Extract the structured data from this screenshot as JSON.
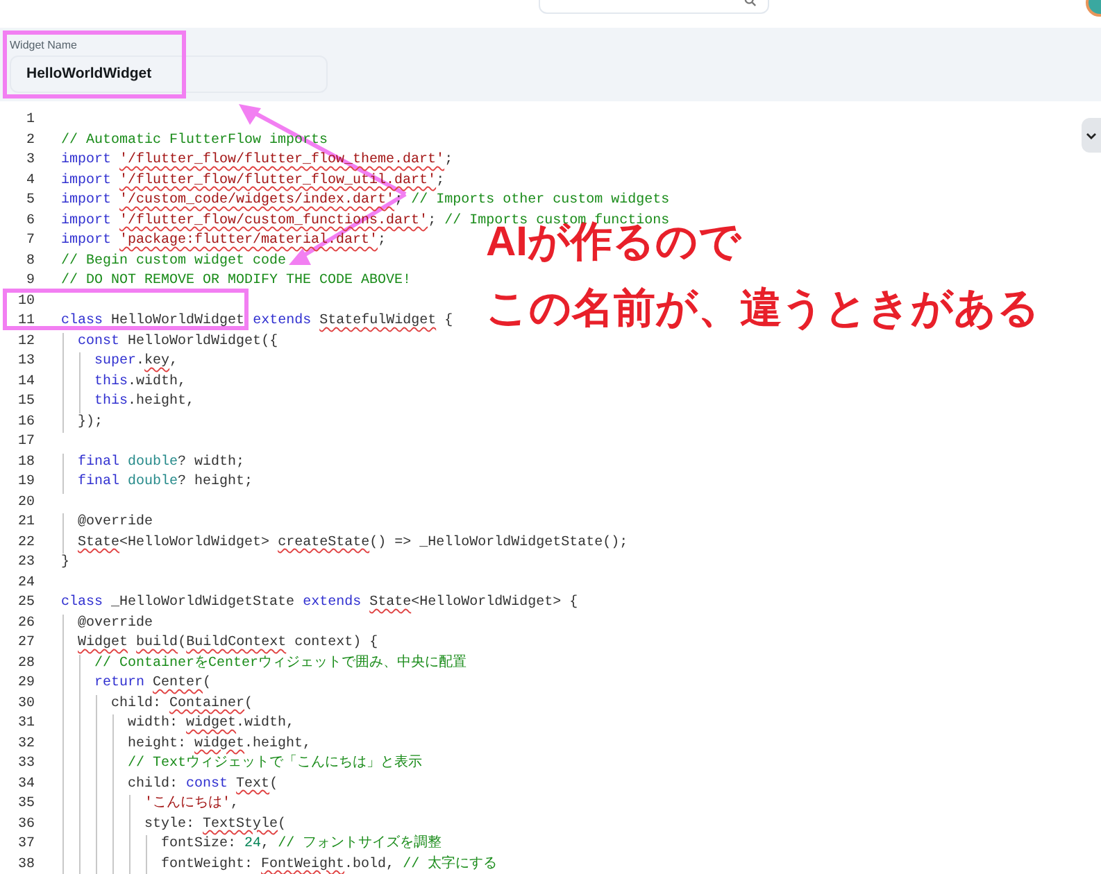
{
  "widget_name": {
    "label": "Widget Name",
    "value": "HelloWorldWidget"
  },
  "code_lines": [
    {
      "number": "1"
    },
    {
      "number": "2",
      "tokens": [
        {
          "text": "// Automatic FlutterFlow imports",
          "kind": "comment"
        }
      ]
    },
    {
      "number": "3",
      "tokens": [
        {
          "text": "import ",
          "kind": "keyword"
        },
        {
          "text": "'/flutter_flow/flutter_flow_theme.dart'",
          "kind": "unresolved_string"
        },
        {
          "text": ";",
          "kind": "plain"
        }
      ]
    },
    {
      "number": "4",
      "tokens": [
        {
          "text": "import ",
          "kind": "keyword"
        },
        {
          "text": "'/flutter_flow/flutter_flow_util.dart'",
          "kind": "unresolved_string"
        },
        {
          "text": ";",
          "kind": "plain"
        }
      ]
    },
    {
      "number": "5",
      "tokens": [
        {
          "text": "import ",
          "kind": "keyword"
        },
        {
          "text": "'/custom_code/widgets/index.dart'",
          "kind": "unresolved_string"
        },
        {
          "text": "; ",
          "kind": "plain"
        },
        {
          "text": "// Imports other custom widgets",
          "kind": "comment"
        }
      ]
    },
    {
      "number": "6",
      "tokens": [
        {
          "text": "import ",
          "kind": "keyword"
        },
        {
          "text": "'/flutter_flow/custom_functions.dart'",
          "kind": "unresolved_string"
        },
        {
          "text": "; ",
          "kind": "plain"
        },
        {
          "text": "// Imports custom functions",
          "kind": "comment"
        }
      ]
    },
    {
      "number": "7",
      "tokens": [
        {
          "text": "import ",
          "kind": "keyword"
        },
        {
          "text": "'package:flutter/material.dart'",
          "kind": "unresolved_string"
        },
        {
          "text": ";",
          "kind": "plain"
        }
      ]
    },
    {
      "number": "8",
      "tokens": [
        {
          "text": "// Begin custom widget code",
          "kind": "comment"
        }
      ]
    },
    {
      "number": "9",
      "tokens": [
        {
          "text": "// DO NOT REMOVE OR MODIFY THE CODE ABOVE!",
          "kind": "comment"
        }
      ]
    },
    {
      "number": "10"
    },
    {
      "number": "11",
      "tokens": [
        {
          "text": "class",
          "kind": "keyword"
        },
        {
          "text": " HelloWorldWidget ",
          "kind": "plain"
        },
        {
          "text": "extends ",
          "kind": "keyword"
        },
        {
          "text": "StatefulWidget",
          "kind": "unresolved"
        },
        {
          "text": " {",
          "kind": "plain"
        }
      ]
    },
    {
      "number": "12",
      "tokens": [
        {
          "text": "  const",
          "kind": "keyword"
        },
        {
          "text": " HelloWorldWidget({",
          "kind": "plain"
        }
      ]
    },
    {
      "number": "13",
      "tokens": [
        {
          "text": "    super",
          "kind": "keyword"
        },
        {
          "text": ".",
          "kind": "plain"
        },
        {
          "text": "key",
          "kind": "unresolved"
        },
        {
          "text": ",",
          "kind": "plain"
        }
      ]
    },
    {
      "number": "14",
      "tokens": [
        {
          "text": "    this",
          "kind": "keyword"
        },
        {
          "text": ".width,",
          "kind": "plain"
        }
      ]
    },
    {
      "number": "15",
      "tokens": [
        {
          "text": "    this",
          "kind": "keyword"
        },
        {
          "text": ".height,",
          "kind": "plain"
        }
      ]
    },
    {
      "number": "16",
      "tokens": [
        {
          "text": "  });",
          "kind": "plain"
        }
      ]
    },
    {
      "number": "17"
    },
    {
      "number": "18",
      "tokens": [
        {
          "text": "  final ",
          "kind": "keyword"
        },
        {
          "text": "double",
          "kind": "type"
        },
        {
          "text": "? width;",
          "kind": "plain"
        }
      ]
    },
    {
      "number": "19",
      "tokens": [
        {
          "text": "  final ",
          "kind": "keyword"
        },
        {
          "text": "double",
          "kind": "type"
        },
        {
          "text": "? height;",
          "kind": "plain"
        }
      ]
    },
    {
      "number": "20"
    },
    {
      "number": "21",
      "tokens": [
        {
          "text": "  @override",
          "kind": "plain"
        }
      ]
    },
    {
      "number": "22",
      "tokens": [
        {
          "text": "  State",
          "kind": "unresolved"
        },
        {
          "text": "<HelloWorldWidget> ",
          "kind": "plain"
        },
        {
          "text": "createState",
          "kind": "unresolved"
        },
        {
          "text": "() => _HelloWorldWidgetState();",
          "kind": "plain"
        }
      ]
    },
    {
      "number": "23",
      "tokens": [
        {
          "text": "}",
          "kind": "plain"
        }
      ]
    },
    {
      "number": "24"
    },
    {
      "number": "25",
      "tokens": [
        {
          "text": "class",
          "kind": "keyword"
        },
        {
          "text": " _HelloWorldWidgetState ",
          "kind": "plain"
        },
        {
          "text": "extends ",
          "kind": "keyword"
        },
        {
          "text": "State",
          "kind": "unresolved"
        },
        {
          "text": "<HelloWorldWidget> {",
          "kind": "plain"
        }
      ]
    },
    {
      "number": "26",
      "tokens": [
        {
          "text": "  @override",
          "kind": "plain"
        }
      ]
    },
    {
      "number": "27",
      "tokens": [
        {
          "text": "  Widget",
          "kind": "unresolved"
        },
        {
          "text": " build",
          "kind": "unresolved"
        },
        {
          "text": "(",
          "kind": "plain"
        },
        {
          "text": "BuildContext",
          "kind": "unresolved"
        },
        {
          "text": " context) {",
          "kind": "plain"
        }
      ]
    },
    {
      "number": "28",
      "tokens": [
        {
          "text": "    // ContainerをCenterウィジェットで囲み、中央に配置",
          "kind": "comment"
        }
      ]
    },
    {
      "number": "29",
      "tokens": [
        {
          "text": "    return ",
          "kind": "keyword"
        },
        {
          "text": "Center",
          "kind": "unresolved"
        },
        {
          "text": "(",
          "kind": "plain"
        }
      ]
    },
    {
      "number": "30",
      "tokens": [
        {
          "text": "      child: ",
          "kind": "plain"
        },
        {
          "text": "Container",
          "kind": "unresolved"
        },
        {
          "text": "(",
          "kind": "plain"
        }
      ]
    },
    {
      "number": "31",
      "tokens": [
        {
          "text": "        width: ",
          "kind": "plain"
        },
        {
          "text": "widget",
          "kind": "unresolved"
        },
        {
          "text": ".width,",
          "kind": "plain"
        }
      ]
    },
    {
      "number": "32",
      "tokens": [
        {
          "text": "        height: ",
          "kind": "plain"
        },
        {
          "text": "widget",
          "kind": "unresolved"
        },
        {
          "text": ".height,",
          "kind": "plain"
        }
      ]
    },
    {
      "number": "33",
      "tokens": [
        {
          "text": "        // Textウィジェットで「こんにちは」と表示",
          "kind": "comment"
        }
      ]
    },
    {
      "number": "34",
      "tokens": [
        {
          "text": "        child: ",
          "kind": "plain"
        },
        {
          "text": "const ",
          "kind": "keyword"
        },
        {
          "text": "Text",
          "kind": "unresolved"
        },
        {
          "text": "(",
          "kind": "plain"
        }
      ]
    },
    {
      "number": "35",
      "tokens": [
        {
          "text": "          'こんにちは'",
          "kind": "string"
        },
        {
          "text": ",",
          "kind": "plain"
        }
      ]
    },
    {
      "number": "36",
      "tokens": [
        {
          "text": "          style: ",
          "kind": "plain"
        },
        {
          "text": "TextStyle",
          "kind": "unresolved"
        },
        {
          "text": "(",
          "kind": "plain"
        }
      ]
    },
    {
      "number": "37",
      "tokens": [
        {
          "text": "            fontSize: ",
          "kind": "plain"
        },
        {
          "text": "24",
          "kind": "number"
        },
        {
          "text": ", ",
          "kind": "plain"
        },
        {
          "text": "// フォントサイズを調整",
          "kind": "comment"
        }
      ]
    },
    {
      "number": "38",
      "tokens": [
        {
          "text": "            fontWeight: ",
          "kind": "plain"
        },
        {
          "text": "FontWeight",
          "kind": "unresolved"
        },
        {
          "text": ".bold, ",
          "kind": "plain"
        },
        {
          "text": "// 太字にする",
          "kind": "comment"
        }
      ]
    }
  ],
  "annotations": [
    {
      "text": "AIが作るので"
    },
    {
      "text": "この名前が、違うときがある"
    }
  ]
}
